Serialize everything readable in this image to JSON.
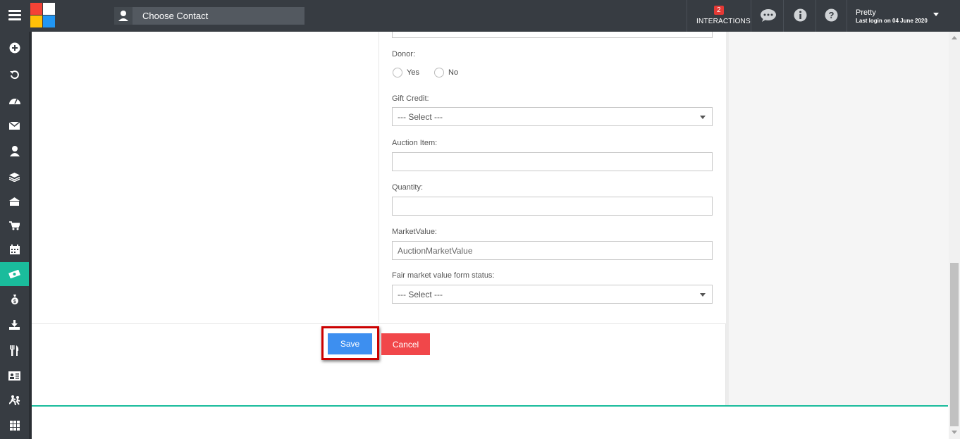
{
  "header": {
    "choose_contact": "Choose Contact",
    "interactions_count": "2",
    "interactions_label": "INTERACTIONS",
    "user_name": "Pretty",
    "last_login": "Last login on 04 June 2020"
  },
  "sidebar": {
    "items": [
      "add-icon",
      "history-icon",
      "dashboard-icon",
      "mail-icon",
      "person-icon",
      "layers-icon",
      "bank-icon",
      "cart-icon",
      "calendar-icon",
      "donation-icon",
      "money-bag-icon",
      "download-icon",
      "dining-icon",
      "contact-card-icon",
      "run-icon",
      "apps-icon"
    ],
    "active_index": 9
  },
  "form": {
    "donor_label": "Donor:",
    "donor_yes": "Yes",
    "donor_no": "No",
    "gift_credit_label": "Gift Credit:",
    "gift_credit_value": "--- Select ---",
    "auction_item_label": "Auction Item:",
    "auction_item_value": "",
    "quantity_label": "Quantity:",
    "quantity_value": "",
    "market_value_label": "MarketValue:",
    "market_value_placeholder": "AuctionMarketValue",
    "fmv_status_label": "Fair market value form status:",
    "fmv_status_value": "--- Select ---"
  },
  "actions": {
    "save_label": "Save",
    "cancel_label": "Cancel"
  },
  "colors": {
    "topbar": "#373c42",
    "accent": "#1abc9c",
    "save": "#3d8ff0",
    "cancel": "#f1474a",
    "highlight": "#cc0000"
  }
}
